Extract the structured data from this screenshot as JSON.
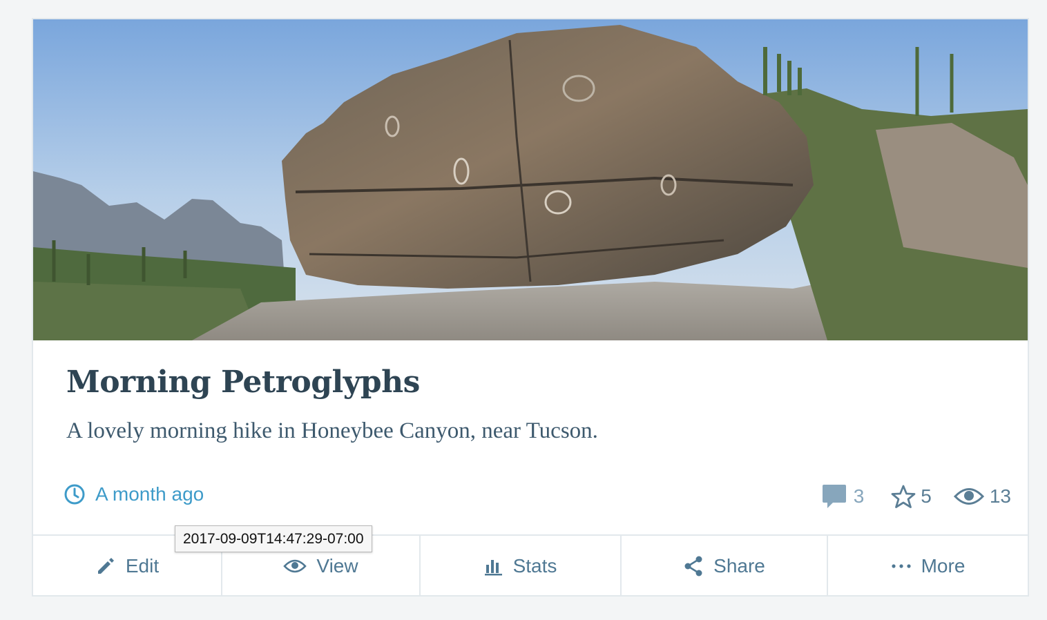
{
  "post": {
    "title": "Morning Petroglyphs",
    "excerpt": "A lovely morning hike in Honeybee Canyon, near Tucson.",
    "date_relative": "A month ago",
    "date_tooltip": "2017-09-09T14:47:29-07:00",
    "hero_icon": "featured-image-petroglyph-boulder"
  },
  "stats": {
    "comments": "3",
    "likes": "5",
    "views": "13"
  },
  "actions": {
    "edit": "Edit",
    "view": "View",
    "stats": "Stats",
    "share": "Share",
    "more": "More"
  },
  "colors": {
    "title": "#2e4453",
    "link": "#3e9bc9",
    "action": "#4f7893",
    "stat_muted": "#87a6bc"
  }
}
